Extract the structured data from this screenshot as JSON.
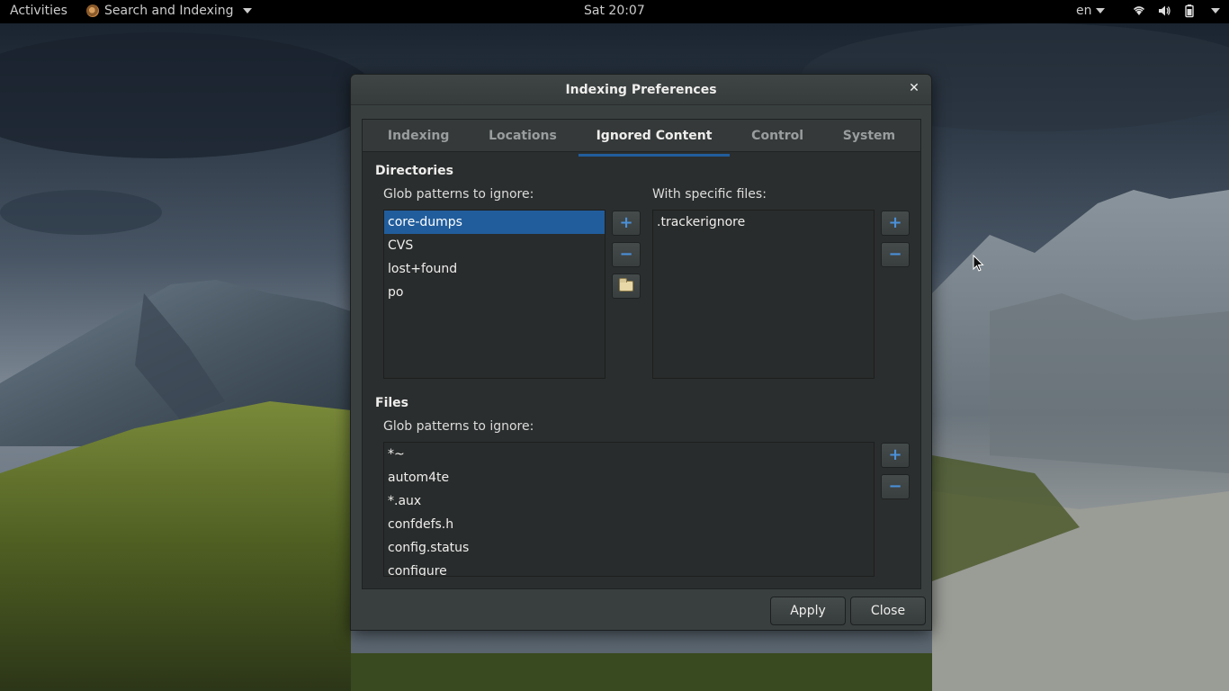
{
  "topbar": {
    "activities": "Activities",
    "app_name": "Search and Indexing",
    "clock": "Sat 20:07",
    "language": "en",
    "tray_icons": [
      "wifi-icon",
      "volume-icon",
      "battery-icon"
    ]
  },
  "dialog": {
    "title": "Indexing Preferences",
    "tabs": [
      {
        "label": "Indexing"
      },
      {
        "label": "Locations"
      },
      {
        "label": "Ignored Content"
      },
      {
        "label": "Control"
      },
      {
        "label": "System"
      }
    ],
    "active_tab": "Ignored Content",
    "directories": {
      "title": "Directories",
      "glob_label": "Glob patterns to ignore:",
      "glob_items": [
        "core-dumps",
        "CVS",
        "lost+found",
        "po"
      ],
      "selected": "core-dumps",
      "specific_label": "With specific files:",
      "specific_items": [
        ".trackerignore"
      ]
    },
    "files": {
      "title": "Files",
      "glob_label": "Glob patterns to ignore:",
      "glob_items": [
        "*~",
        "autom4te",
        "*.aux",
        "confdefs.h",
        "config.status",
        "configure"
      ]
    },
    "buttons": {
      "apply": "Apply",
      "close": "Close"
    }
  },
  "colors": {
    "accent": "#215d9c",
    "icon_blue": "#4a90d9",
    "dialog_bg": "#393f3f",
    "panel_bg": "#2b2e2e"
  }
}
